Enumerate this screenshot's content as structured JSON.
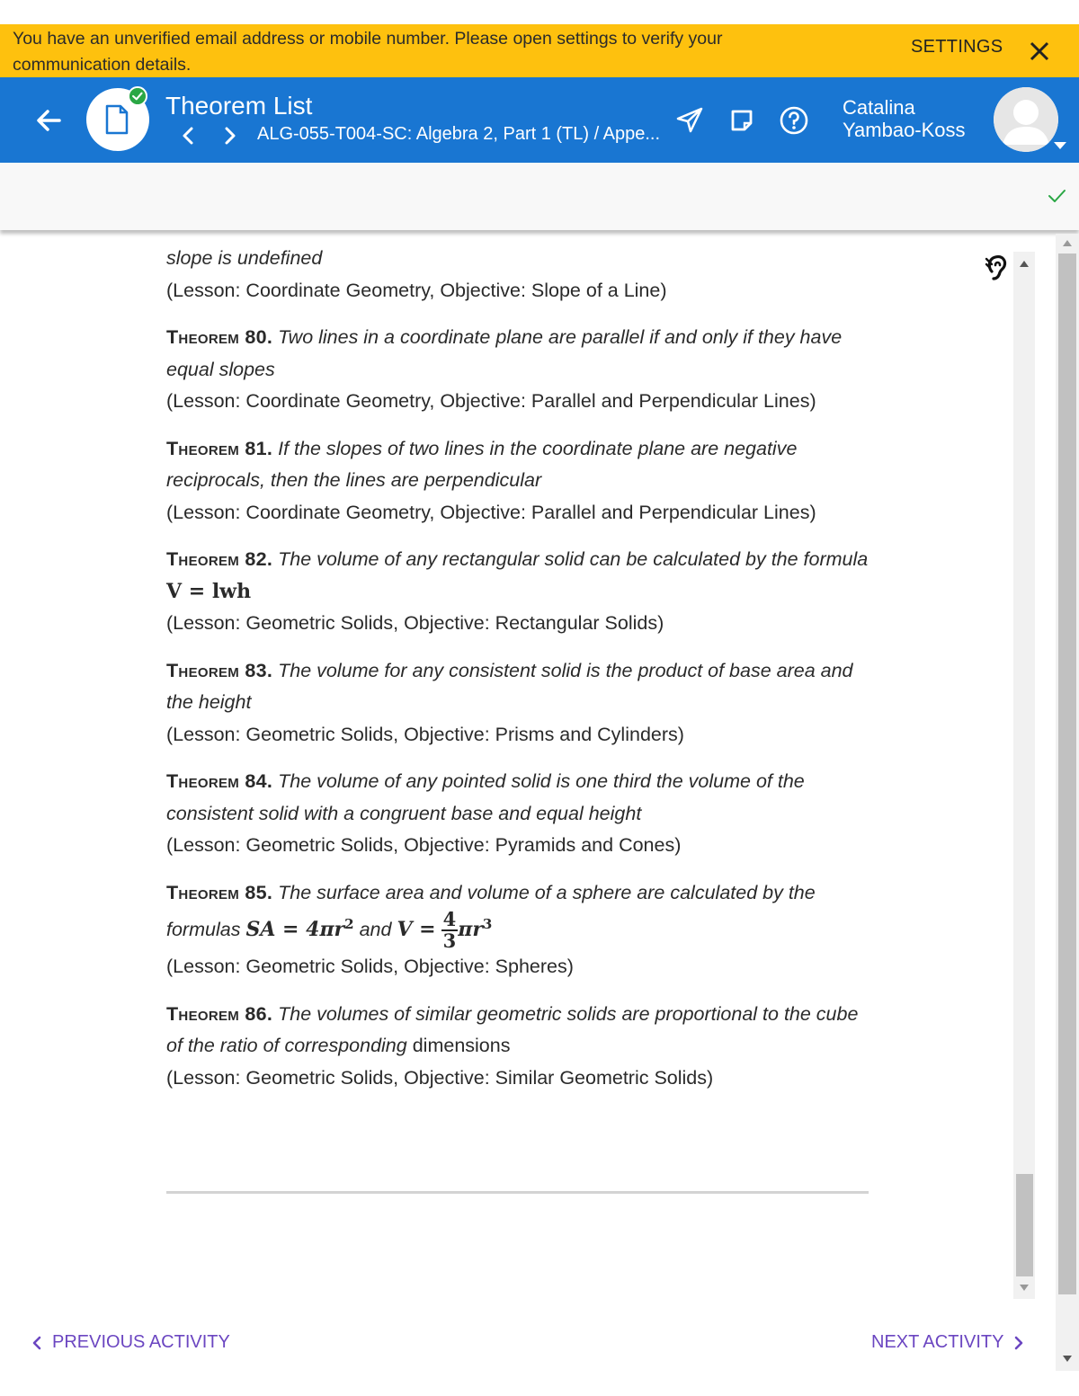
{
  "banner": {
    "message": "You have an unverified email address or mobile number. Please open settings to verify your communication details.",
    "settings_label": "SETTINGS"
  },
  "header": {
    "title": "Theorem List",
    "breadcrumb": "ALG-055-T004-SC: Algebra 2, Part 1 (TL) / Appe...",
    "user_first": "Catalina",
    "user_last": "Yambao-Koss"
  },
  "content": {
    "intro_line": "slope is undefined",
    "intro_lesson": "(Lesson: Coordinate Geometry, Objective: Slope of a Line)",
    "theorems": [
      {
        "label": "Theorem 80.",
        "statement": "Two lines in a coordinate plane are parallel if and only if they have equal slopes",
        "lesson": "(Lesson: Coordinate Geometry, Objective: Parallel and Perpendicular Lines)"
      },
      {
        "label": "Theorem 81.",
        "statement": "If the slopes of two lines in the coordinate plane are negative reciprocals, then the lines are perpendicular",
        "lesson": "(Lesson: Coordinate Geometry, Objective: Parallel and Perpendicular Lines)"
      },
      {
        "label": "Theorem 82.",
        "statement": "The volume of any rectangular solid can be calculated by the formula",
        "formula": "V = lwh",
        "lesson": "(Lesson: Geometric Solids, Objective: Rectangular Solids)"
      },
      {
        "label": "Theorem 83.",
        "statement": "The volume for any consistent solid is the product of base area and the height",
        "lesson": "(Lesson: Geometric Solids, Objective: Prisms and Cylinders)"
      },
      {
        "label": "Theorem 84.",
        "statement": "The volume of any pointed solid is one third the volume of the consistent solid with a congruent base and equal height",
        "lesson": "(Lesson: Geometric Solids, Objective: Pyramids and Cones)"
      },
      {
        "label": "Theorem 85.",
        "statement": "The surface area and volume of a sphere are calculated by the formulas",
        "formula_sa": "SA = 4πr",
        "formula_sa_exp": "2",
        "connector": "and",
        "formula_v_lhs": "V =",
        "frac_num": "4",
        "frac_den": "3",
        "formula_v_rhs": "πr",
        "formula_v_exp": "3",
        "lesson": "(Lesson: Geometric Solids, Objective: Spheres)"
      },
      {
        "label": "Theorem 86.",
        "statement": "The volumes of similar geometric solids are proportional to the cube of the ratio of corresponding",
        "statement_tail": "dimensions",
        "lesson": "(Lesson: Geometric Solids, Objective: Similar Geometric Solids)"
      }
    ]
  },
  "footer": {
    "prev_label": "PREVIOUS ACTIVITY",
    "next_label": "NEXT ACTIVITY"
  },
  "colors": {
    "banner_bg": "#fec10e",
    "appbar_bg": "#1976d2",
    "nav_link": "#6b46c1",
    "check_green": "#2aa745"
  },
  "icons": [
    "close-icon",
    "back-arrow-icon",
    "document-icon",
    "check-badge-icon",
    "chevron-left-icon",
    "chevron-right-icon",
    "send-icon",
    "note-icon",
    "help-icon",
    "avatar-icon",
    "caret-down-icon",
    "checkmark-icon",
    "listen-icon"
  ]
}
